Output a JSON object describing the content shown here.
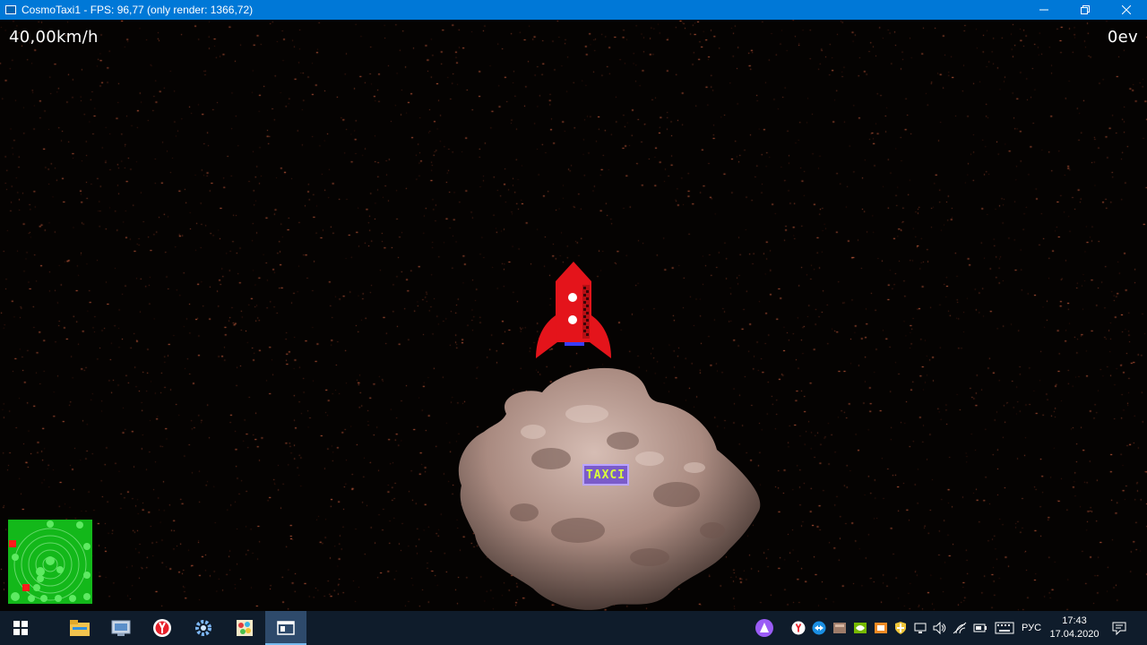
{
  "window": {
    "title": "CosmoTaxi1 - FPS: 96,77 (only render: 1366,72)",
    "controls": [
      "minimize-icon",
      "restore-icon",
      "close-icon"
    ]
  },
  "hud": {
    "speed": "40,00km/h",
    "money": "0ev"
  },
  "scene": {
    "taxi_sign": "TAXCI",
    "rocket_color": "#e4141b",
    "asteroid_color": "#b5978e",
    "radar_color": "#13b81a"
  },
  "taskbar": {
    "apps": [
      "windows-start-icon",
      "file-explorer-icon",
      "control-panel-icon",
      "yandex-browser-icon",
      "settings-gear-icon",
      "paint-icon",
      "cosmotaxi-window-icon"
    ],
    "tray": [
      "alice-assistant-icon",
      "yandex-icon",
      "teamviewer-icon",
      "tray-app-icon",
      "nvidia-icon",
      "tray-app2-icon",
      "security-shield-icon",
      "device-icon",
      "volume-icon",
      "wifi-icon",
      "battery-icon",
      "keyboard-icon"
    ],
    "language": "РУС",
    "time": "17:43",
    "date": "17.04.2020"
  }
}
